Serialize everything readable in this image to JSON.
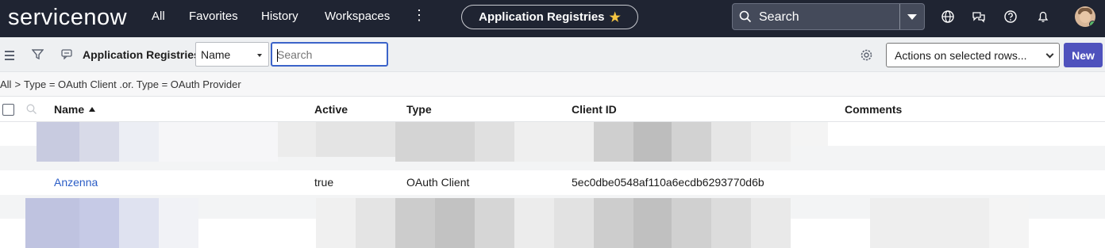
{
  "topnav": {
    "brand": "servicenow",
    "items": [
      "All",
      "Favorites",
      "History",
      "Workspaces"
    ],
    "app_title": "Application Registries",
    "search_placeholder": "Search"
  },
  "list": {
    "title": "Application Registries",
    "field_select": "Name",
    "search_placeholder": "Search",
    "actions_label": "Actions on selected rows...",
    "new_label": "New"
  },
  "breadcrumb": {
    "root": "All",
    "separator": ">",
    "condition": "Type = OAuth Client .or. Type = OAuth Provider"
  },
  "columns": {
    "name": "Name",
    "active": "Active",
    "type": "Type",
    "client_id": "Client ID",
    "comments": "Comments"
  },
  "rows": [
    {
      "name": "Anzenna",
      "active": "true",
      "type": "OAuth Client",
      "client_id": "5ec0dbe0548af110a6ecdb6293770d6b",
      "comments": ""
    }
  ],
  "colors": {
    "topbar": "#1f2432",
    "accent": "#4f52bd",
    "link": "#2a5cc6",
    "focus": "#3b63c9"
  }
}
